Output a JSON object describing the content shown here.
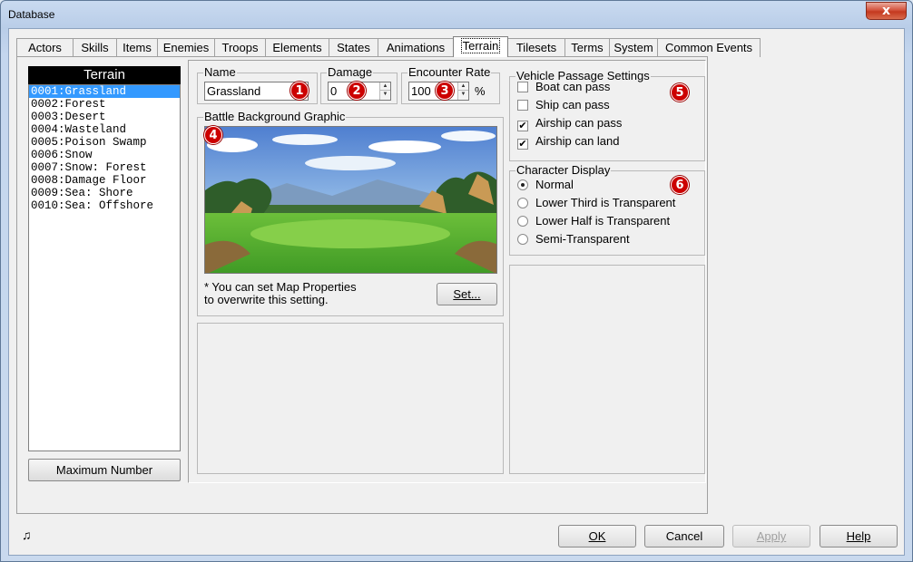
{
  "window": {
    "title": "Database",
    "close_glyph": "x"
  },
  "tabs": [
    {
      "label": "Actors"
    },
    {
      "label": "Skills"
    },
    {
      "label": "Items"
    },
    {
      "label": "Enemies"
    },
    {
      "label": "Troops"
    },
    {
      "label": "Elements"
    },
    {
      "label": "States"
    },
    {
      "label": "Animations"
    },
    {
      "label": "Terrain",
      "active": true
    },
    {
      "label": "Tilesets"
    },
    {
      "label": "Terms"
    },
    {
      "label": "System"
    },
    {
      "label": "Common Events"
    }
  ],
  "list": {
    "header": "Terrain",
    "items": [
      "0001:Grassland",
      "0002:Forest",
      "0003:Desert",
      "0004:Wasteland",
      "0005:Poison Swamp",
      "0006:Snow",
      "0007:Snow: Forest",
      "0008:Damage Floor",
      "0009:Sea: Shore",
      "0010:Sea: Offshore"
    ],
    "selected_index": 0,
    "max_button": "Maximum Number"
  },
  "name_group": {
    "label": "Name",
    "value": "Grassland",
    "marker": "1"
  },
  "damage_group": {
    "label": "Damage",
    "value": "0",
    "marker": "2"
  },
  "encounter_group": {
    "label": "Encounter Rate",
    "value": "100",
    "unit": "%",
    "marker": "3"
  },
  "battle_bg": {
    "label": "Battle Background Graphic",
    "marker": "4",
    "note_line1": "* You can set Map Properties",
    "note_line2": "to overwrite this setting.",
    "set_button": "Set..."
  },
  "vehicle": {
    "label": "Vehicle Passage Settings",
    "marker": "5",
    "options": [
      {
        "label": "Boat can pass",
        "checked": false
      },
      {
        "label": "Ship can pass",
        "checked": false
      },
      {
        "label": "Airship can pass",
        "checked": true
      },
      {
        "label": "Airship can land",
        "checked": true
      }
    ]
  },
  "char_display": {
    "label": "Character Display",
    "marker": "6",
    "options": [
      {
        "label": "Normal",
        "selected": true
      },
      {
        "label": "Lower Third is Transparent",
        "selected": false
      },
      {
        "label": "Lower Half is Transparent",
        "selected": false
      },
      {
        "label": "Semi-Transparent",
        "selected": false
      }
    ]
  },
  "footer": {
    "ok": "OK",
    "cancel": "Cancel",
    "apply": "Apply",
    "help": "Help",
    "music_icon": "music-note-icon"
  },
  "colors": {
    "accent": "#3399ff",
    "marker": "#cc0000"
  }
}
